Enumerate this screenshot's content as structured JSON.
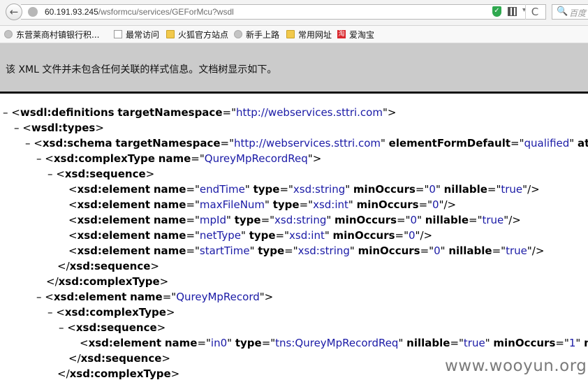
{
  "navigation": {
    "back_glyph": "←",
    "url_host": "60.191.93.245",
    "url_path": "/wsformcu/services/GEForMcu?wsdl",
    "reload_glyph": "C",
    "search_placeholder": "百度"
  },
  "bookmarks": [
    {
      "label": "东营莱商村镇银行积...",
      "icon": "globe-icon"
    },
    {
      "label": "最常访问",
      "icon": "document-icon"
    },
    {
      "label": "火狐官方站点",
      "icon": "folder-icon"
    },
    {
      "label": "新手上路",
      "icon": "globe-icon"
    },
    {
      "label": "常用网址",
      "icon": "folder-icon"
    },
    {
      "label": "爱淘宝",
      "icon": "taobao-icon"
    }
  ],
  "banner": {
    "text": "该 XML 文件并未包含任何关联的样式信息。文档树显示如下。"
  },
  "xml_lines": [
    {
      "indent": 0,
      "toggle": "–",
      "segments": [
        [
          "pun",
          "<"
        ],
        [
          "tag",
          "wsdl:definitions"
        ],
        [
          "sp",
          " "
        ],
        [
          "tag",
          "targetNamespace"
        ],
        [
          "pun",
          "=\""
        ],
        [
          "val",
          "http://webservices.sttri.com"
        ],
        [
          "pun",
          "\">"
        ]
      ]
    },
    {
      "indent": 1,
      "toggle": "–",
      "segments": [
        [
          "pun",
          "<"
        ],
        [
          "tag",
          "wsdl:types"
        ],
        [
          "pun",
          ">"
        ]
      ]
    },
    {
      "indent": 2,
      "toggle": "–",
      "segments": [
        [
          "pun",
          "<"
        ],
        [
          "tag",
          "xsd:schema"
        ],
        [
          "sp",
          " "
        ],
        [
          "tag",
          "targetNamespace"
        ],
        [
          "pun",
          "=\""
        ],
        [
          "val",
          "http://webservices.sttri.com"
        ],
        [
          "pun",
          "\""
        ],
        [
          "sp",
          " "
        ],
        [
          "tag",
          "elementFormDefault"
        ],
        [
          "pun",
          "=\""
        ],
        [
          "val",
          "qualified"
        ],
        [
          "pun",
          "\""
        ],
        [
          "sp",
          " "
        ],
        [
          "tag",
          "attrib"
        ]
      ]
    },
    {
      "indent": 3,
      "toggle": "–",
      "segments": [
        [
          "pun",
          "<"
        ],
        [
          "tag",
          "xsd:complexType"
        ],
        [
          "sp",
          " "
        ],
        [
          "tag",
          "name"
        ],
        [
          "pun",
          "=\""
        ],
        [
          "val",
          "QureyMpRecordReq"
        ],
        [
          "pun",
          "\">"
        ]
      ]
    },
    {
      "indent": 4,
      "toggle": "–",
      "segments": [
        [
          "pun",
          "<"
        ],
        [
          "tag",
          "xsd:sequence"
        ],
        [
          "pun",
          ">"
        ]
      ]
    },
    {
      "indent": 5,
      "toggle": "",
      "segments": [
        [
          "pun",
          "<"
        ],
        [
          "tag",
          "xsd:element"
        ],
        [
          "sp",
          " "
        ],
        [
          "tag",
          "name"
        ],
        [
          "pun",
          "=\""
        ],
        [
          "val",
          "endTime"
        ],
        [
          "pun",
          "\""
        ],
        [
          "sp",
          " "
        ],
        [
          "tag",
          "type"
        ],
        [
          "pun",
          "=\""
        ],
        [
          "val",
          "xsd:string"
        ],
        [
          "pun",
          "\""
        ],
        [
          "sp",
          " "
        ],
        [
          "tag",
          "minOccurs"
        ],
        [
          "pun",
          "=\""
        ],
        [
          "val",
          "0"
        ],
        [
          "pun",
          "\""
        ],
        [
          "sp",
          " "
        ],
        [
          "tag",
          "nillable"
        ],
        [
          "pun",
          "=\""
        ],
        [
          "val",
          "true"
        ],
        [
          "pun",
          "\"/>"
        ]
      ]
    },
    {
      "indent": 5,
      "toggle": "",
      "segments": [
        [
          "pun",
          "<"
        ],
        [
          "tag",
          "xsd:element"
        ],
        [
          "sp",
          " "
        ],
        [
          "tag",
          "name"
        ],
        [
          "pun",
          "=\""
        ],
        [
          "val",
          "maxFileNum"
        ],
        [
          "pun",
          "\""
        ],
        [
          "sp",
          " "
        ],
        [
          "tag",
          "type"
        ],
        [
          "pun",
          "=\""
        ],
        [
          "val",
          "xsd:int"
        ],
        [
          "pun",
          "\""
        ],
        [
          "sp",
          " "
        ],
        [
          "tag",
          "minOccurs"
        ],
        [
          "pun",
          "=\""
        ],
        [
          "val",
          "0"
        ],
        [
          "pun",
          "\"/>"
        ]
      ]
    },
    {
      "indent": 5,
      "toggle": "",
      "segments": [
        [
          "pun",
          "<"
        ],
        [
          "tag",
          "xsd:element"
        ],
        [
          "sp",
          " "
        ],
        [
          "tag",
          "name"
        ],
        [
          "pun",
          "=\""
        ],
        [
          "val",
          "mpId"
        ],
        [
          "pun",
          "\""
        ],
        [
          "sp",
          " "
        ],
        [
          "tag",
          "type"
        ],
        [
          "pun",
          "=\""
        ],
        [
          "val",
          "xsd:string"
        ],
        [
          "pun",
          "\""
        ],
        [
          "sp",
          " "
        ],
        [
          "tag",
          "minOccurs"
        ],
        [
          "pun",
          "=\""
        ],
        [
          "val",
          "0"
        ],
        [
          "pun",
          "\""
        ],
        [
          "sp",
          " "
        ],
        [
          "tag",
          "nillable"
        ],
        [
          "pun",
          "=\""
        ],
        [
          "val",
          "true"
        ],
        [
          "pun",
          "\"/>"
        ]
      ]
    },
    {
      "indent": 5,
      "toggle": "",
      "segments": [
        [
          "pun",
          "<"
        ],
        [
          "tag",
          "xsd:element"
        ],
        [
          "sp",
          " "
        ],
        [
          "tag",
          "name"
        ],
        [
          "pun",
          "=\""
        ],
        [
          "val",
          "netType"
        ],
        [
          "pun",
          "\""
        ],
        [
          "sp",
          " "
        ],
        [
          "tag",
          "type"
        ],
        [
          "pun",
          "=\""
        ],
        [
          "val",
          "xsd:int"
        ],
        [
          "pun",
          "\""
        ],
        [
          "sp",
          " "
        ],
        [
          "tag",
          "minOccurs"
        ],
        [
          "pun",
          "=\""
        ],
        [
          "val",
          "0"
        ],
        [
          "pun",
          "\"/>"
        ]
      ]
    },
    {
      "indent": 5,
      "toggle": "",
      "segments": [
        [
          "pun",
          "<"
        ],
        [
          "tag",
          "xsd:element"
        ],
        [
          "sp",
          " "
        ],
        [
          "tag",
          "name"
        ],
        [
          "pun",
          "=\""
        ],
        [
          "val",
          "startTime"
        ],
        [
          "pun",
          "\""
        ],
        [
          "sp",
          " "
        ],
        [
          "tag",
          "type"
        ],
        [
          "pun",
          "=\""
        ],
        [
          "val",
          "xsd:string"
        ],
        [
          "pun",
          "\""
        ],
        [
          "sp",
          " "
        ],
        [
          "tag",
          "minOccurs"
        ],
        [
          "pun",
          "=\""
        ],
        [
          "val",
          "0"
        ],
        [
          "pun",
          "\""
        ],
        [
          "sp",
          " "
        ],
        [
          "tag",
          "nillable"
        ],
        [
          "pun",
          "=\""
        ],
        [
          "val",
          "true"
        ],
        [
          "pun",
          "\"/>"
        ]
      ]
    },
    {
      "indent": 4,
      "toggle": "",
      "segments": [
        [
          "pun",
          "</"
        ],
        [
          "tag",
          "xsd:sequence"
        ],
        [
          "pun",
          ">"
        ]
      ]
    },
    {
      "indent": 3,
      "toggle": "",
      "segments": [
        [
          "pun",
          "</"
        ],
        [
          "tag",
          "xsd:complexType"
        ],
        [
          "pun",
          ">"
        ]
      ]
    },
    {
      "indent": 3,
      "toggle": "–",
      "segments": [
        [
          "pun",
          "<"
        ],
        [
          "tag",
          "xsd:element"
        ],
        [
          "sp",
          " "
        ],
        [
          "tag",
          "name"
        ],
        [
          "pun",
          "=\""
        ],
        [
          "val",
          "QureyMpRecord"
        ],
        [
          "pun",
          "\">"
        ]
      ]
    },
    {
      "indent": 4,
      "toggle": "–",
      "segments": [
        [
          "pun",
          "<"
        ],
        [
          "tag",
          "xsd:complexType"
        ],
        [
          "pun",
          ">"
        ]
      ]
    },
    {
      "indent": 5,
      "toggle": "–",
      "segments": [
        [
          "pun",
          "<"
        ],
        [
          "tag",
          "xsd:sequence"
        ],
        [
          "pun",
          ">"
        ]
      ]
    },
    {
      "indent": 6,
      "toggle": "",
      "segments": [
        [
          "pun",
          "<"
        ],
        [
          "tag",
          "xsd:element"
        ],
        [
          "sp",
          " "
        ],
        [
          "tag",
          "name"
        ],
        [
          "pun",
          "=\""
        ],
        [
          "val",
          "in0"
        ],
        [
          "pun",
          "\""
        ],
        [
          "sp",
          " "
        ],
        [
          "tag",
          "type"
        ],
        [
          "pun",
          "=\""
        ],
        [
          "val",
          "tns:QureyMpRecordReq"
        ],
        [
          "pun",
          "\""
        ],
        [
          "sp",
          " "
        ],
        [
          "tag",
          "nillable"
        ],
        [
          "pun",
          "=\""
        ],
        [
          "val",
          "true"
        ],
        [
          "pun",
          "\""
        ],
        [
          "sp",
          " "
        ],
        [
          "tag",
          "minOccurs"
        ],
        [
          "pun",
          "=\""
        ],
        [
          "val",
          "1"
        ],
        [
          "pun",
          "\""
        ],
        [
          "sp",
          " "
        ],
        [
          "tag",
          "ma"
        ]
      ]
    },
    {
      "indent": 5,
      "toggle": "",
      "segments": [
        [
          "pun",
          "</"
        ],
        [
          "tag",
          "xsd:sequence"
        ],
        [
          "pun",
          ">"
        ]
      ]
    },
    {
      "indent": 4,
      "toggle": "",
      "segments": [
        [
          "pun",
          "</"
        ],
        [
          "tag",
          "xsd:complexType"
        ],
        [
          "pun",
          ">"
        ]
      ]
    }
  ],
  "watermark": "www.wooyun.org"
}
